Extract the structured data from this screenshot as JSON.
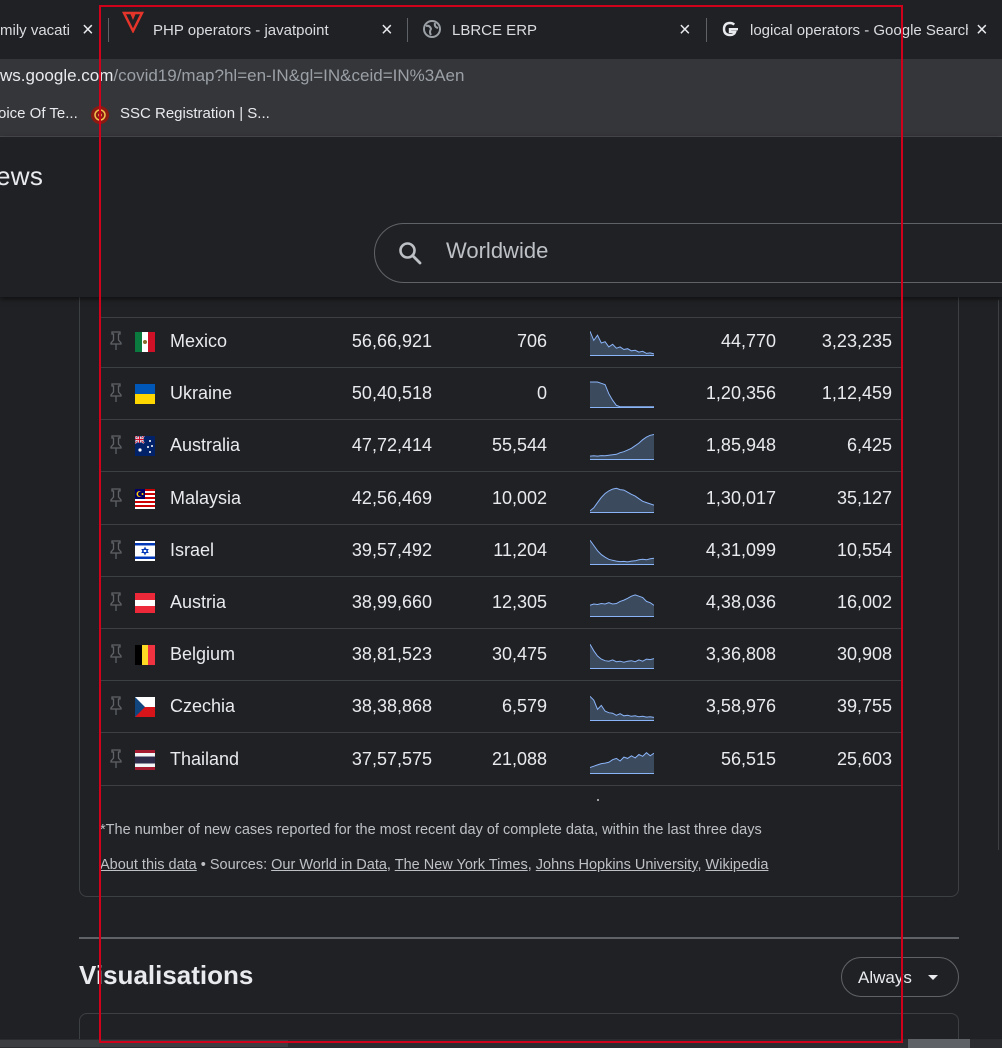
{
  "tabs": [
    {
      "title": "mily vacati"
    },
    {
      "title": "PHP operators - javatpoint"
    },
    {
      "title": "LBRCE ERP"
    },
    {
      "title": "logical operators - Google Search"
    }
  ],
  "address": {
    "host": "ws.google.com",
    "path": "/covid19/map?hl=en-IN&gl=IN&ceid=IN%3Aen"
  },
  "bookmarks": [
    {
      "label": "oice Of Te..."
    },
    {
      "label": "SSC Registration | S..."
    }
  ],
  "header": {
    "logo_text": "ews",
    "search_text": "Worldwide"
  },
  "table": {
    "rows": [
      {
        "country": "Mexico",
        "flag": "mexico",
        "total": "56,66,921",
        "new": "706",
        "per_million": "44,770",
        "deaths": "3,23,235"
      },
      {
        "country": "Ukraine",
        "flag": "ukraine",
        "total": "50,40,518",
        "new": "0",
        "per_million": "1,20,356",
        "deaths": "1,12,459"
      },
      {
        "country": "Australia",
        "flag": "australia",
        "total": "47,72,414",
        "new": "55,544",
        "per_million": "1,85,948",
        "deaths": "6,425"
      },
      {
        "country": "Malaysia",
        "flag": "malaysia",
        "total": "42,56,469",
        "new": "10,002",
        "per_million": "1,30,017",
        "deaths": "35,127"
      },
      {
        "country": "Israel",
        "flag": "israel",
        "total": "39,57,492",
        "new": "11,204",
        "per_million": "4,31,099",
        "deaths": "10,554"
      },
      {
        "country": "Austria",
        "flag": "austria",
        "total": "38,99,660",
        "new": "12,305",
        "per_million": "4,38,036",
        "deaths": "16,002"
      },
      {
        "country": "Belgium",
        "flag": "belgium",
        "total": "38,81,523",
        "new": "30,475",
        "per_million": "3,36,808",
        "deaths": "30,908"
      },
      {
        "country": "Czechia",
        "flag": "czechia",
        "total": "38,38,868",
        "new": "6,579",
        "per_million": "3,58,976",
        "deaths": "39,755"
      },
      {
        "country": "Thailand",
        "flag": "thailand",
        "total": "37,57,575",
        "new": "21,088",
        "per_million": "56,515",
        "deaths": "25,603"
      }
    ]
  },
  "footnote": "*The number of new cases reported for the most recent day of complete data, within the last three days",
  "sources": {
    "about": "About this data",
    "prefix": " • Sources: ",
    "links": [
      "Our World in Data",
      "The New York Times",
      "Johns Hopkins University",
      "Wikipedia"
    ]
  },
  "visualisations": {
    "title": "Visualisations",
    "button_label": "Always"
  },
  "colors": {
    "background": "#202124",
    "spark_fill": "#3c4a5e",
    "spark_line": "#8ab4f8",
    "selection": "#d0021b"
  }
}
